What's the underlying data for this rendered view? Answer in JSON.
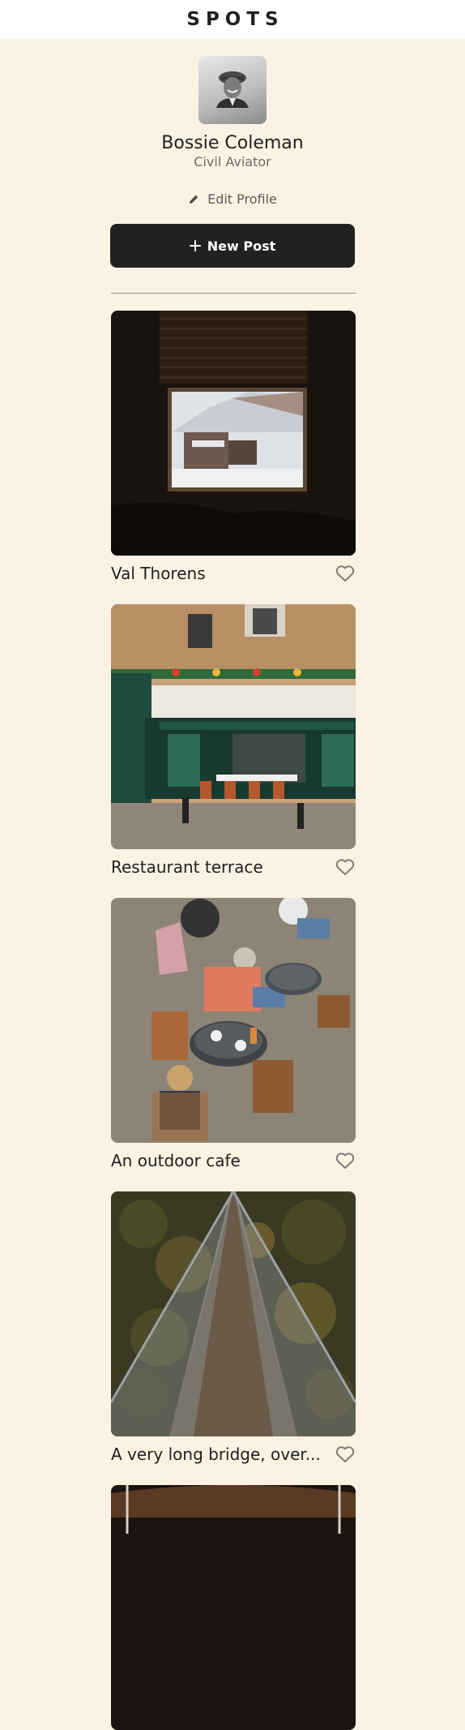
{
  "header": {
    "logo": "SPOTS"
  },
  "profile": {
    "name": "Bossie Coleman",
    "description": "Civil Aviator",
    "edit_label": "Edit Profile",
    "new_post_label": "New Post"
  },
  "cards": [
    {
      "title": "Val Thorens",
      "liked": false
    },
    {
      "title": "Restaurant terrace",
      "liked": false
    },
    {
      "title": "An outdoor cafe",
      "liked": false
    },
    {
      "title": "A very long bridge, over...",
      "liked": false
    }
  ],
  "colors": {
    "background": "#FBF2E3",
    "button": "#212121",
    "text": "#212121"
  }
}
